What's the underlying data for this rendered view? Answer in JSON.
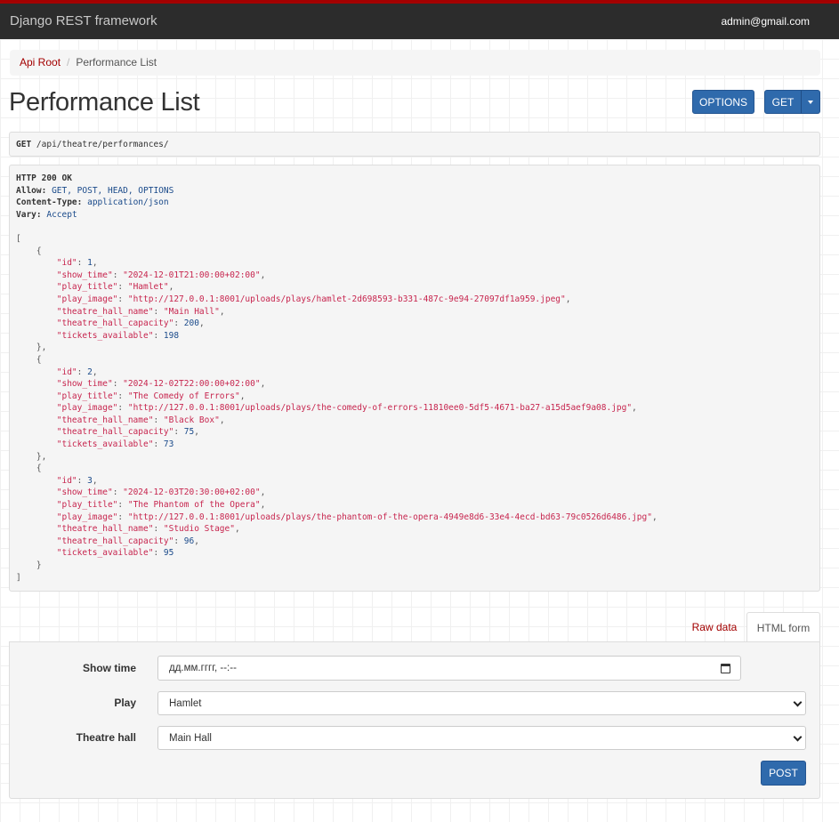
{
  "navbar": {
    "brand": "Django REST framework",
    "user": "admin@gmail.com"
  },
  "breadcrumb": {
    "items": [
      {
        "label": "Api Root"
      },
      {
        "label": "Performance List"
      }
    ]
  },
  "page": {
    "title": "Performance List"
  },
  "actions": {
    "options_label": "OPTIONS",
    "get_label": "GET",
    "caret_icon": "caret-down-icon"
  },
  "request": {
    "method": "GET",
    "path": "/api/theatre/performances/"
  },
  "response": {
    "status": "HTTP 200 OK",
    "headers": [
      {
        "name": "Allow:",
        "value": "GET, POST, HEAD, OPTIONS"
      },
      {
        "name": "Content-Type:",
        "value": "application/json"
      },
      {
        "name": "Vary:",
        "value": "Accept"
      }
    ],
    "items": [
      {
        "id": "1",
        "show_time": "\"2024-12-01T21:00:00+02:00\"",
        "play_title": "\"Hamlet\"",
        "play_image": "\"http://127.0.0.1:8001/uploads/plays/hamlet-2d698593-b331-487c-9e94-27097df1a959.jpeg\"",
        "theatre_hall_name": "\"Main Hall\"",
        "theatre_hall_capacity": "200",
        "tickets_available": "198"
      },
      {
        "id": "2",
        "show_time": "\"2024-12-02T22:00:00+02:00\"",
        "play_title": "\"The Comedy of Errors\"",
        "play_image": "\"http://127.0.0.1:8001/uploads/plays/the-comedy-of-errors-11810ee0-5df5-4671-ba27-a15d5aef9a08.jpg\"",
        "theatre_hall_name": "\"Black Box\"",
        "theatre_hall_capacity": "75",
        "tickets_available": "73"
      },
      {
        "id": "3",
        "show_time": "\"2024-12-03T20:30:00+02:00\"",
        "play_title": "\"The Phantom of the Opera\"",
        "play_image": "\"http://127.0.0.1:8001/uploads/plays/the-phantom-of-the-opera-4949e8d6-33e4-4ecd-bd63-79c0526d6486.jpg\"",
        "theatre_hall_name": "\"Studio Stage\"",
        "theatre_hall_capacity": "96",
        "tickets_available": "95"
      }
    ]
  },
  "tabs": [
    {
      "label": "Raw data"
    },
    {
      "label": "HTML form"
    }
  ],
  "form": {
    "show_time_label": "Show time",
    "show_time_value": "дд.мм.гггг, --:--",
    "play_label": "Play",
    "play_value": "Hamlet",
    "hall_label": "Theatre hall",
    "hall_value": "Main Hall",
    "post_label": "POST"
  }
}
